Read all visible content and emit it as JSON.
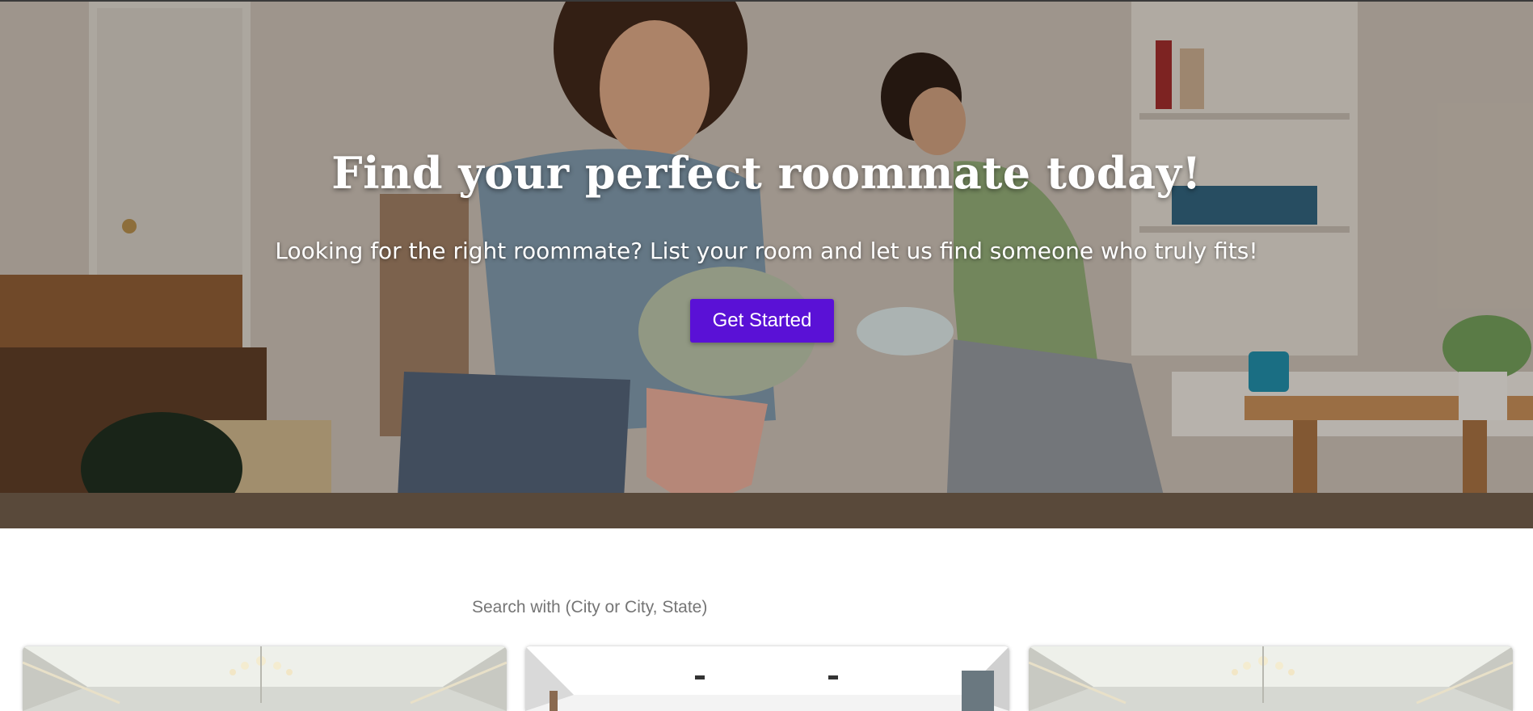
{
  "hero": {
    "title": "Find your perfect roommate today!",
    "subtitle": "Looking for the right roommate? List your room and let us find someone who truly fits!",
    "cta_label": "Get Started",
    "background_image": "two-women-moving-in-with-plants-icon"
  },
  "search": {
    "placeholder": "Search with (City or City, State)",
    "value": ""
  },
  "listings": [
    {
      "image": "room-with-chandelier-icon"
    },
    {
      "image": "bright-living-room-icon"
    },
    {
      "image": "room-with-chandelier-icon"
    }
  ],
  "colors": {
    "accent": "#5a11d6",
    "text_on_hero": "#ffffff",
    "placeholder": "#757575"
  }
}
